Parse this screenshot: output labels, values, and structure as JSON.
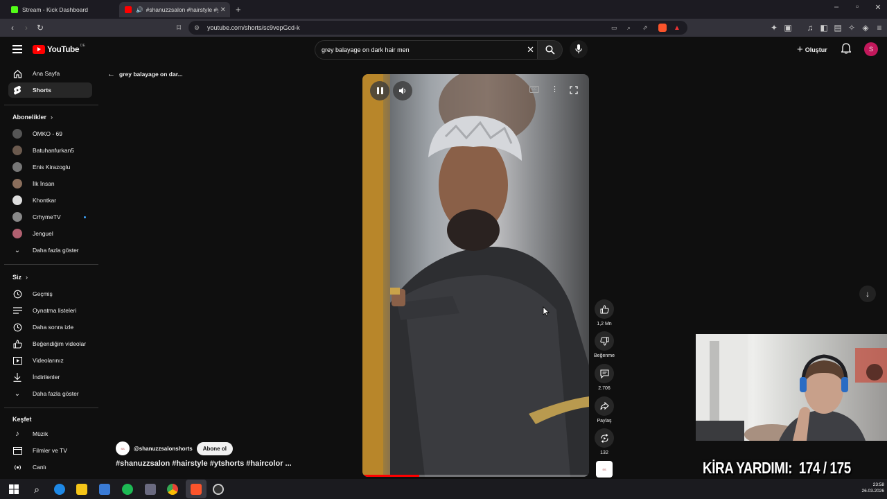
{
  "tabs": [
    {
      "title": "Stream - Kick Dashboard",
      "color": "#53fc18"
    },
    {
      "title": "#shanuzzsalon #hairstyle #yts",
      "color": "#ff0000"
    }
  ],
  "address": {
    "url": "youtube.com/shorts/sc9vepGcd-k"
  },
  "header": {
    "logo_text": "YouTube",
    "region": "DE",
    "search_value": "grey balayage on dark hair men",
    "create_label": "Oluştur",
    "avatar_letter": "S"
  },
  "sidebar": {
    "main": [
      {
        "label": "Ana Sayfa",
        "icon": "home-icon"
      },
      {
        "label": "Shorts",
        "icon": "shorts-icon"
      }
    ],
    "subs_title": "Abonelikler",
    "subs": [
      {
        "label": "ÖMKO - 69",
        "color": "#555"
      },
      {
        "label": "Batuhanfurkan5",
        "color": "#6b5a4e"
      },
      {
        "label": "Enis Kirazoglu",
        "color": "#777"
      },
      {
        "label": "İlk İnsan",
        "color": "#8a6e5c"
      },
      {
        "label": "Khontkar",
        "color": "#ddd"
      },
      {
        "label": "CrhymeTV",
        "color": "#888"
      },
      {
        "label": "Jenguel",
        "color": "#b06070"
      }
    ],
    "show_more": "Daha fazla göster",
    "you_title": "Siz",
    "you": [
      {
        "label": "Geçmiş",
        "icon": "history-icon"
      },
      {
        "label": "Oynatma listeleri",
        "icon": "playlist-icon"
      },
      {
        "label": "Daha sonra izle",
        "icon": "clock-icon"
      },
      {
        "label": "Beğendiğim videolar",
        "icon": "like-icon"
      },
      {
        "label": "Videolarınız",
        "icon": "video-icon"
      },
      {
        "label": "İndirilenler",
        "icon": "download-icon"
      },
      {
        "label": "Daha fazla göster",
        "icon": "chevron-down-icon"
      }
    ],
    "explore_title": "Keşfet",
    "explore": [
      {
        "label": "Müzik",
        "icon": "music-icon"
      },
      {
        "label": "Filmler ve TV",
        "icon": "film-icon"
      },
      {
        "label": "Canlı",
        "icon": "live-icon"
      }
    ]
  },
  "back_label": "grey balayage on dar...",
  "short": {
    "channel": "@shanuzzsalonshorts",
    "subscribe": "Abone ol",
    "title": "#shanuzzsalon #hairstyle #ytshorts #haircolor ...",
    "progress": 0.25
  },
  "actions": {
    "likes": "1,2 Mn",
    "dislike": "Beğenme",
    "comments": "2.706",
    "share": "Paylaş",
    "remix": "132"
  },
  "overlay": {
    "text": "KİRA YARDIMI:  174 / 175"
  },
  "taskbar": {
    "time": "23:58",
    "date": "26.03.2026"
  }
}
